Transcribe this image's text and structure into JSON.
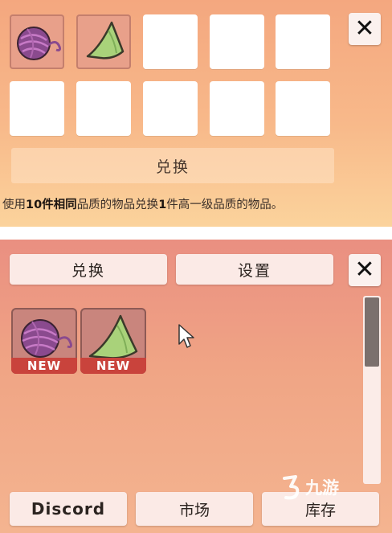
{
  "exchange_panel": {
    "slots": [
      {
        "filled": true,
        "icon": "yarn-ball-icon"
      },
      {
        "filled": true,
        "icon": "green-hat-icon"
      },
      {
        "filled": false
      },
      {
        "filled": false
      },
      {
        "filled": false
      },
      {
        "filled": false
      },
      {
        "filled": false
      },
      {
        "filled": false
      },
      {
        "filled": false
      },
      {
        "filled": false
      }
    ],
    "close_label": "✕",
    "exchange_label": "兑换",
    "hint": {
      "p1": "使用",
      "b1": "10件相同",
      "p2": "品质的物品兑换",
      "b2": "1",
      "p3": "件高一级品质的物品。"
    }
  },
  "inventory_panel": {
    "tabs": {
      "exchange": "兑换",
      "settings": "设置"
    },
    "close_label": "✕",
    "items": [
      {
        "icon": "yarn-ball-icon",
        "badge": "NEW"
      },
      {
        "icon": "green-hat-icon",
        "badge": "NEW"
      }
    ],
    "scrollbar": {
      "position": 0.0
    },
    "bottom_buttons": {
      "discord": "Discord",
      "market": "市场",
      "inventory": "库存"
    }
  },
  "watermark": {
    "text": "九游",
    "icon": "jiuyou-logo-icon"
  },
  "colors": {
    "panel_top": "#f4a77f",
    "panel_bottom": "#ea8f81",
    "badge_red": "#c9433c",
    "hat_green": "#a9d27a",
    "yarn_purple": "#8a4a8e"
  }
}
